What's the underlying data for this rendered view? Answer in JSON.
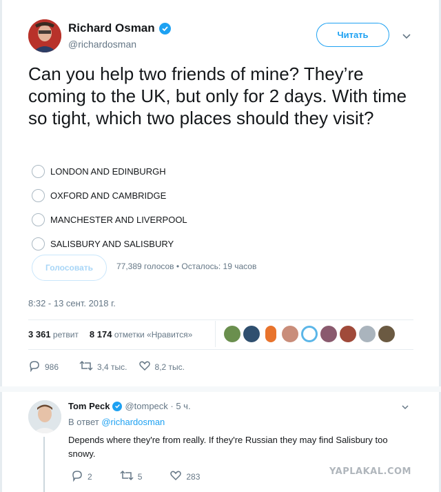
{
  "tweet": {
    "author": "Richard Osman",
    "handle": "@richardosman",
    "follow_label": "Читать",
    "text": "Can you help two friends of mine? They’re coming to the UK, but only for 2 days. With time so tight, which two places should they visit?",
    "poll": {
      "options": [
        "LONDON AND EDINBURGH",
        "OXFORD AND CAMBRIDGE",
        "MANCHESTER AND LIVERPOOL",
        "SALISBURY AND SALISBURY"
      ],
      "vote_label": "Голосовать",
      "meta": "77,389 голосов • Осталось: 19 часов"
    },
    "timestamp": "8:32 - 13 сент. 2018 г.",
    "stats": {
      "retweets_count": "3 361",
      "retweets_label": "ретвит",
      "likes_count": "8 174",
      "likes_label": "отметки «Нравится»"
    },
    "actions": {
      "replies": "986",
      "retweets": "3,4 тыс.",
      "likes": "8,2 тыс."
    }
  },
  "reply": {
    "author": "Tom Peck",
    "handle": "@tompeck · 5 ч.",
    "in_reply_prefix": "В ответ",
    "in_reply_handle": "@richardosman",
    "text": "Depends where they're from really. If they're Russian they may find Salisbury too snowy.",
    "actions": {
      "replies": "2",
      "retweets": "5",
      "likes": "283"
    }
  },
  "watermark": "YAPLAKAL.COM",
  "colors": {
    "accent": "#1da1f2",
    "muted": "#657786",
    "text": "#14171a"
  }
}
